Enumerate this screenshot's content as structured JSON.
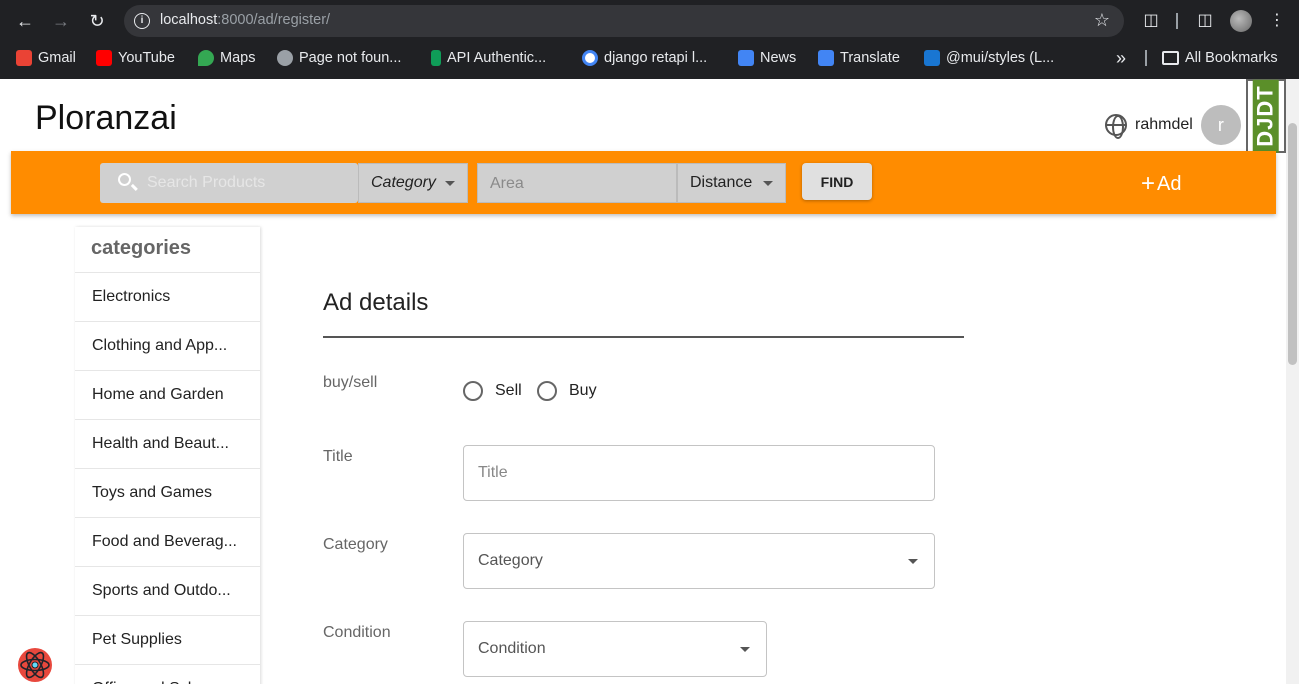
{
  "browser": {
    "url_host": "localhost",
    "url_path": ":8000/ad/register/",
    "bookmarks": [
      {
        "label": "Gmail",
        "color": "#ea4335"
      },
      {
        "label": "YouTube",
        "color": "#ff0000"
      },
      {
        "label": "Maps",
        "color": "#34a853"
      },
      {
        "label": "Page not foun...",
        "color": "#9aa0a6"
      },
      {
        "label": "API Authentic...",
        "color": "#0f9d58"
      },
      {
        "label": "django retapi l...",
        "color": "#4285f4"
      },
      {
        "label": "News",
        "color": "#4285f4"
      },
      {
        "label": "Translate",
        "color": "#4285f4"
      },
      {
        "label": "@mui/styles (L...",
        "color": "#1976d2"
      }
    ],
    "overflow_label": "»",
    "all_bookmarks": "All Bookmarks"
  },
  "header": {
    "logo": "Ploranzai",
    "username": "rahmdel",
    "avatar_letter": "r",
    "djdt": "DJDT"
  },
  "toolbar": {
    "search_placeholder": "Search Products",
    "category_label": "Category",
    "area_placeholder": "Area",
    "distance_label": "Distance",
    "find_label": "FIND",
    "add_ad_label": "Ad",
    "add_ad_plus": "+",
    "color": "#ff8c00"
  },
  "sidebar": {
    "heading": "categories",
    "items": [
      "Electronics",
      "Clothing and App...",
      "Home and Garden",
      "Health and Beaut...",
      "Toys and Games",
      "Food and Beverag...",
      "Sports and Outdo...",
      "Pet Supplies",
      "Office and Sch..."
    ]
  },
  "form": {
    "title": "Ad details",
    "buysell_label": "buy/sell",
    "radio_sell": "Sell",
    "radio_buy": "Buy",
    "title_label": "Title",
    "title_placeholder": "Title",
    "category_label": "Category",
    "category_value": "Category",
    "condition_label": "Condition",
    "condition_value": "Condition"
  }
}
